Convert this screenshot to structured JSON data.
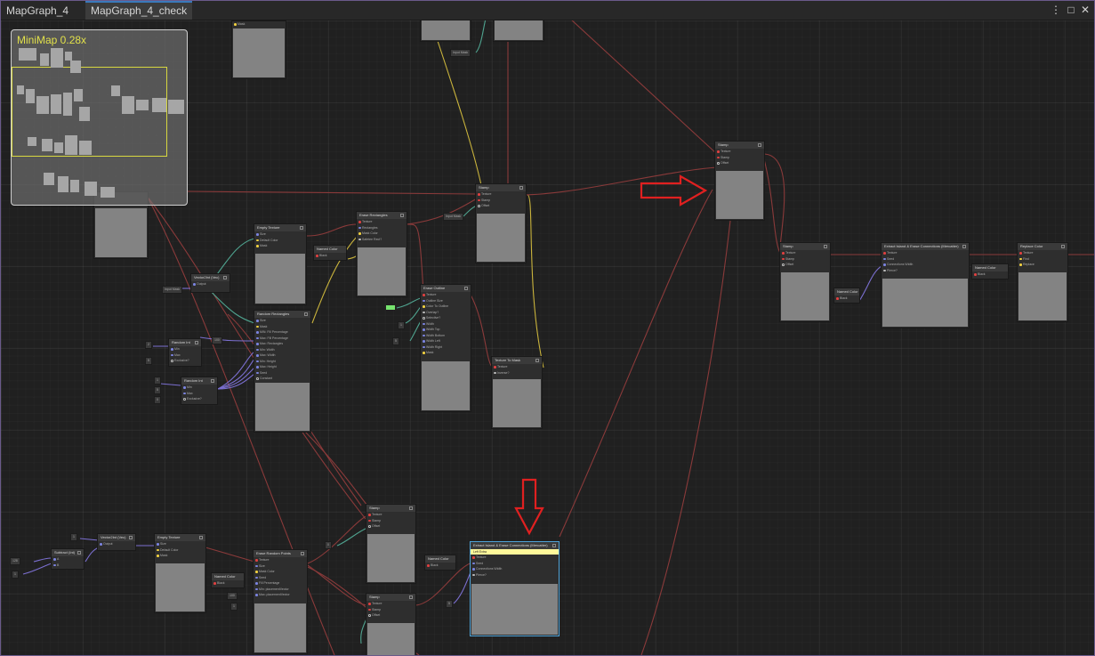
{
  "tabs": [
    {
      "label": "MapGraph_4"
    },
    {
      "label": "MapGraph_4_check"
    }
  ],
  "window_controls": {
    "more": "⋮",
    "maximize": "□",
    "close": "✕"
  },
  "minimap": {
    "label": "MiniMap  0.28x"
  },
  "nodes": {
    "stamp_top": {
      "title": "Stamp",
      "ports": [
        "Texture",
        "Stamp",
        "Offset"
      ],
      "out": "Texture"
    },
    "stamp_mid": {
      "title": "Stamp",
      "ports": [
        "Texture",
        "Stamp",
        "Offset"
      ],
      "out": "Texture"
    },
    "stamp_right": {
      "title": "Stamp",
      "ports": [
        "Texture",
        "Stamp",
        "Offset"
      ],
      "out": "Texture"
    },
    "stamp_bottom1": {
      "title": "Stamp",
      "ports": [
        "Texture",
        "Stamp",
        "Offset"
      ],
      "out": "Texture"
    },
    "stamp_bottom2": {
      "title": "Stamp",
      "ports": [
        "Texture",
        "Stamp",
        "Offset"
      ],
      "out": "Texture"
    },
    "empty_texture_1": {
      "title": "Empty Texture",
      "ports": [
        "Size",
        "Default Color",
        "Mask"
      ],
      "out": "Empty Texture"
    },
    "empty_texture_2": {
      "title": "Empty Texture",
      "ports": [
        "Size",
        "Default Color",
        "Mask"
      ],
      "out": "Empty Texture"
    },
    "erase_rectangles": {
      "title": "Erase Rectangles",
      "ports": [
        "Texture",
        "Rectangles",
        "Mask Color",
        "Safetee Rect?"
      ],
      "out": "Texture"
    },
    "random_rectangles": {
      "title": "Random Rectangles",
      "ports": [
        "Size",
        "Mask",
        "MIN: Fill Percentage",
        "Max: Fill Percentage",
        "Max: Rectangles",
        "Min: Width",
        "Max: Width",
        "Min: Height",
        "Max: Height",
        "Seed",
        "Constant"
      ],
      "out": "Rectangles"
    },
    "erase_outline": {
      "title": "Erase Outline",
      "ports": [
        "Texture",
        "Outline Size",
        "Color To Outline",
        "Overlap?",
        "Selective?",
        "Width",
        "Width Top",
        "Width Bottom",
        "Width Left",
        "Width Right",
        "Mask"
      ],
      "out": "Texture"
    },
    "texture_to_mask": {
      "title": "Texture To Mask",
      "ports": [
        "Texture",
        "Inverse?"
      ],
      "out": "Mask"
    },
    "vector2int_1": {
      "title": "Vector2Int (Vec)",
      "ports": [
        "X",
        "Y"
      ],
      "out": "Output"
    },
    "vector2int_2": {
      "title": "Vector2Int (Vec)",
      "ports": [
        "X",
        "Y"
      ],
      "out": "Output"
    },
    "random_int_1": {
      "title": "Random Int",
      "ports": [
        "Min",
        "Max",
        "Exclusive?"
      ],
      "out": "Value"
    },
    "random_int_2": {
      "title": "Random Int",
      "ports": [
        "Min",
        "Max",
        "Exclusive?"
      ],
      "out": "Value"
    },
    "subtract_int": {
      "title": "Subtract (Int)",
      "ports": [
        "A",
        "B"
      ],
      "out": "Result"
    },
    "erase_random_points": {
      "title": "Erase Random Points",
      "ports": [
        "Texture",
        "Size",
        "Mask Color",
        "Seed",
        "Fill Percentage",
        "Min: placementVector",
        "Max: placementVector"
      ],
      "out": "Texture"
    },
    "extract_edges_right": {
      "title": "Extract Island & Erase Connections (Mercatter)",
      "ports": [
        "Texture",
        "Seed",
        "Connections Width",
        "Pierce?"
      ],
      "out": "Texture"
    },
    "extract_edges_bottom": {
      "title": "Extract Island & Erase Connections (Mercatter)",
      "banner": "Left Extra",
      "ports": [
        "Texture",
        "Seed",
        "Connections Width",
        "Pierce?"
      ],
      "out": "Texture"
    },
    "replace_color": {
      "title": "Replace Color",
      "ports": [
        "Texture",
        "Find",
        "Replace"
      ],
      "out": "Texture"
    },
    "named_color_1": {
      "title": "Named Color",
      "value": "Black"
    },
    "named_color_2": {
      "title": "Named Color",
      "value": "Black"
    },
    "named_color_3": {
      "title": "Named Color",
      "value": "Black"
    },
    "named_color_4": {
      "title": "Named Color",
      "value": "Black"
    },
    "named_color_5": {
      "title": "Named Color",
      "value": "Black"
    }
  },
  "chips": {
    "input_mask": "Input Mask",
    "num_100": "100",
    "num_50": "50",
    "num_1": "1",
    "num_2": "2",
    "num_0": "0",
    "num_5": "5",
    "num_128": "128"
  },
  "colors": {
    "wire_texture": "#8a3a3a",
    "wire_int": "#7b6fd0",
    "wire_mask": "#c9b33c",
    "wire_teal": "#4fa38f",
    "annotation_arrow": "#e02020",
    "minimap_label": "#e1e04a"
  }
}
